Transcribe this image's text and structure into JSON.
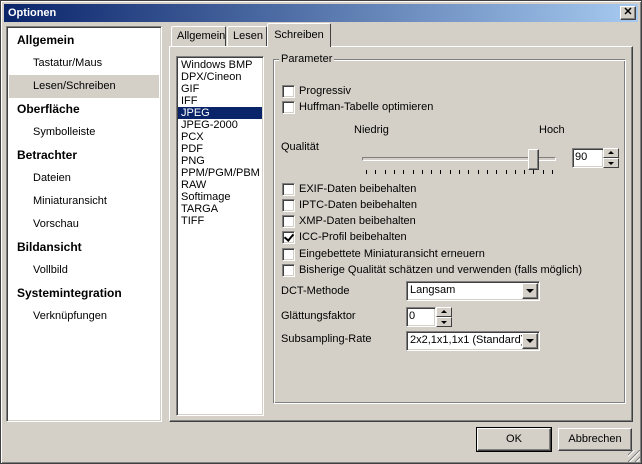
{
  "window": {
    "title": "Optionen"
  },
  "nav": {
    "items": [
      {
        "label": "Allgemein",
        "type": "head"
      },
      {
        "label": "Tastatur/Maus",
        "type": "sub"
      },
      {
        "label": "Lesen/Schreiben",
        "type": "sub",
        "selected": true
      },
      {
        "label": "Oberfläche",
        "type": "head"
      },
      {
        "label": "Symbolleiste",
        "type": "sub"
      },
      {
        "label": "Betrachter",
        "type": "head"
      },
      {
        "label": "Dateien",
        "type": "sub"
      },
      {
        "label": "Miniaturansicht",
        "type": "sub"
      },
      {
        "label": "Vorschau",
        "type": "sub"
      },
      {
        "label": "Bildansicht",
        "type": "head"
      },
      {
        "label": "Vollbild",
        "type": "sub"
      },
      {
        "label": "Systemintegration",
        "type": "head"
      },
      {
        "label": "Verknüpfungen",
        "type": "sub"
      }
    ]
  },
  "tabs": [
    {
      "label": "Allgemein"
    },
    {
      "label": "Lesen"
    },
    {
      "label": "Schreiben",
      "active": true
    }
  ],
  "formats": [
    "Windows BMP",
    "DPX/Cineon",
    "GIF",
    "IFF",
    "JPEG",
    "JPEG-2000",
    "PCX",
    "PDF",
    "PNG",
    "PPM/PGM/PBM",
    "RAW",
    "Softimage",
    "TARGA",
    "TIFF"
  ],
  "selected_format": "JPEG",
  "params": {
    "group_label": "Parameter",
    "progressive": {
      "label": "Progressiv",
      "checked": false
    },
    "huffman": {
      "label": "Huffman-Tabelle optimieren",
      "checked": false
    },
    "quality": {
      "label": "Qualität",
      "low": "Niedrig",
      "high": "Hoch",
      "value": "90",
      "min": 0,
      "max": 100
    },
    "checkboxes": [
      {
        "label": "EXIF-Daten beibehalten",
        "checked": false
      },
      {
        "label": "IPTC-Daten beibehalten",
        "checked": false
      },
      {
        "label": "XMP-Daten beibehalten",
        "checked": false
      },
      {
        "label": "ICC-Profil beibehalten",
        "checked": true
      },
      {
        "label": "Eingebettete Miniaturansicht erneuern",
        "checked": false
      },
      {
        "label": "Bisherige Qualität schätzen und verwenden (falls möglich)",
        "checked": false
      }
    ],
    "dct": {
      "label": "DCT-Methode",
      "value": "Langsam"
    },
    "smoothing": {
      "label": "Glättungsfaktor",
      "value": "0"
    },
    "subsampling": {
      "label": "Subsampling-Rate",
      "value": "2x2,1x1,1x1 (Standard)"
    }
  },
  "buttons": {
    "ok": "OK",
    "cancel": "Abbrechen"
  },
  "colors": {
    "title_start": "#0a246a",
    "title_end": "#a6caf0",
    "face": "#d4d0c8",
    "selection": "#0a246a"
  }
}
